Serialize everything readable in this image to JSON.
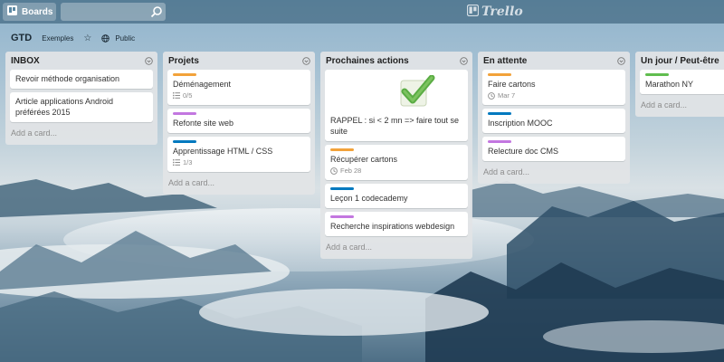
{
  "topbar": {
    "boards_label": "Boards",
    "search_value": "",
    "logo_text": "Trello"
  },
  "board": {
    "title": "GTD",
    "team": "Exemples",
    "visibility": "Public"
  },
  "add_card_label": "Add a card...",
  "lists": [
    {
      "title": "INBOX",
      "cards": [
        {
          "title": "Revoir méthode organisation"
        },
        {
          "title": "Article applications Android préférées 2015"
        }
      ]
    },
    {
      "title": "Projets",
      "cards": [
        {
          "title": "Déménagement",
          "checklist": "0/5"
        },
        {
          "title": "Refonte site web"
        },
        {
          "title": "Apprentissage HTML / CSS",
          "checklist": "1/3"
        }
      ]
    },
    {
      "title": "Prochaines actions",
      "cards": [
        {
          "title": "RAPPEL : si < 2 mn => faire tout se suite"
        },
        {
          "title": "Récupérer cartons",
          "date": "Feb 28"
        },
        {
          "title": "Leçon 1 codecademy"
        },
        {
          "title": "Recherche inspirations webdesign"
        }
      ]
    },
    {
      "title": "En attente",
      "cards": [
        {
          "title": "Faire cartons",
          "date": "Mar 7"
        },
        {
          "title": "Inscription MOOC"
        },
        {
          "title": "Relecture doc CMS"
        }
      ]
    },
    {
      "title": "Un jour / Peut-être",
      "cards": [
        {
          "title": "Marathon NY"
        }
      ]
    }
  ],
  "colors": {
    "label_orange": "#f2a23a",
    "label_purple": "#c377e0",
    "label_blue": "#0079bf",
    "label_green": "#61bd4f",
    "check_green": "#5aac44"
  },
  "icons": {
    "boards": "boards-icon",
    "search": "search-icon",
    "star": "star-icon",
    "globe": "globe-icon",
    "list_menu": "list-menu-icon",
    "checklist": "checklist-icon",
    "clock": "clock-icon",
    "checkmark": "checkmark-image"
  }
}
